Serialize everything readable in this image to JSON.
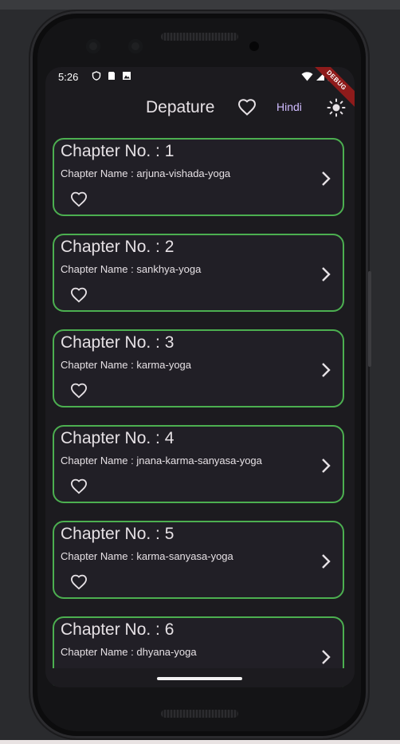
{
  "status_bar": {
    "time": "5:26",
    "debug_label": "DEBUG"
  },
  "app_bar": {
    "title": "Depature",
    "language_button": "Hindi",
    "icons": [
      "heart-outline-icon",
      "sun-icon"
    ]
  },
  "chapters": [
    {
      "title": "Chapter No. : 1",
      "name": "Chapter Name : arjuna-vishada-yoga"
    },
    {
      "title": "Chapter No. : 2",
      "name": "Chapter Name : sankhya-yoga"
    },
    {
      "title": "Chapter No. : 3",
      "name": "Chapter Name : karma-yoga"
    },
    {
      "title": "Chapter No. : 4",
      "name": "Chapter Name : jnana-karma-sanyasa-yoga"
    },
    {
      "title": "Chapter No. : 5",
      "name": "Chapter Name : karma-sanyasa-yoga"
    },
    {
      "title": "Chapter No. : 6",
      "name": "Chapter Name : dhyana-yoga"
    }
  ],
  "colors": {
    "card_border": "#4caf50",
    "background": "#1c1b1f",
    "accent": "#d0bcff"
  }
}
